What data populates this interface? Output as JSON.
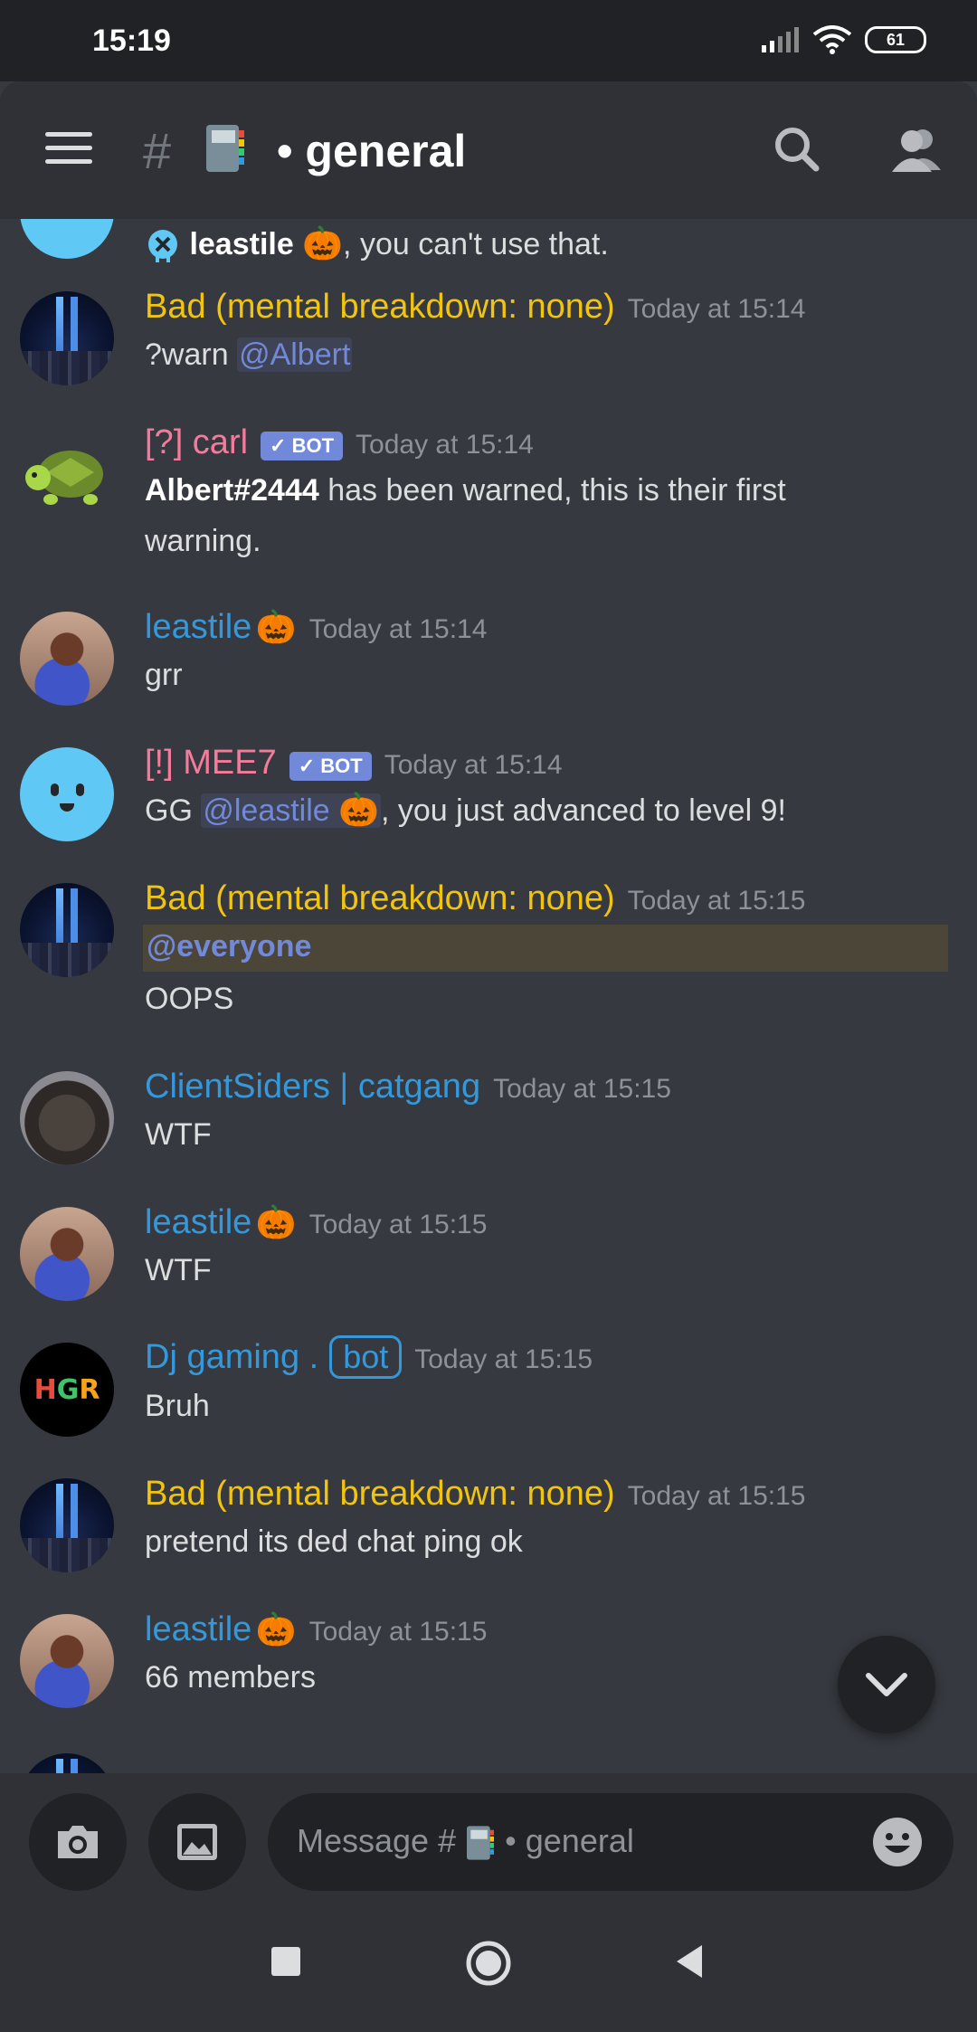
{
  "status_bar": {
    "time": "15:19",
    "battery": "61"
  },
  "header": {
    "hash": "#",
    "separator": "•",
    "channel": "general"
  },
  "messages": {
    "m0": {
      "user": "leastile",
      "text": ", you can't use that."
    },
    "m1": {
      "author": "Bad (mental breakdown: none)",
      "time": "Today at 15:14",
      "text": "?warn ",
      "mention": "@Albert"
    },
    "m2": {
      "author": "[?] carl",
      "badge": "✓ BOT",
      "time": "Today at 15:14",
      "bold": "Albert#2444",
      "line1": " has been warned, this is their first",
      "line2": "warning."
    },
    "m3": {
      "author": "leastile",
      "time": "Today at 15:14",
      "text": "grr"
    },
    "m4": {
      "author": "[!] MEE7",
      "badge": "✓ BOT",
      "time": "Today at 15:14",
      "prefix": "GG ",
      "mention": "@leastile",
      "suffix": ", you just advanced to level 9!"
    },
    "m5": {
      "author": "Bad (mental breakdown: none)",
      "time": "Today at 15:15",
      "mention": "@everyone",
      "text": "OOPS"
    },
    "m6": {
      "author": "ClientSiders | catgang",
      "time": "Today at 15:15",
      "text": "WTF"
    },
    "m7": {
      "author": "leastile",
      "time": "Today at 15:15",
      "text": "WTF"
    },
    "m8": {
      "author": "Dj gaming .",
      "tag": "bot",
      "time": "Today at 15:15",
      "text": "Bruh"
    },
    "m9": {
      "author": "Bad (mental breakdown: none)",
      "time": "Today at 15:15",
      "text": "pretend its ded chat ping ok"
    },
    "m10": {
      "author": "leastile",
      "time": "Today at 15:15",
      "text": "66 members"
    }
  },
  "avatar_hgr": {
    "h": "H",
    "g": "G",
    "r": "R"
  },
  "composer": {
    "placeholder_prefix": "Message #",
    "placeholder_channel": "general",
    "separator": "•"
  },
  "icons": {
    "menu": "hamburger-icon",
    "search": "search-icon",
    "members": "members-icon",
    "camera": "camera-icon",
    "gallery": "image-icon",
    "emoji": "emoji-icon",
    "jump": "chevron-down-icon",
    "pumpkin": "🎃"
  },
  "colors": {
    "yellow": "#f1c40f",
    "pink": "#f47b9c",
    "blue": "#3498db",
    "blurple": "#7289da",
    "bg": "#36393f"
  }
}
